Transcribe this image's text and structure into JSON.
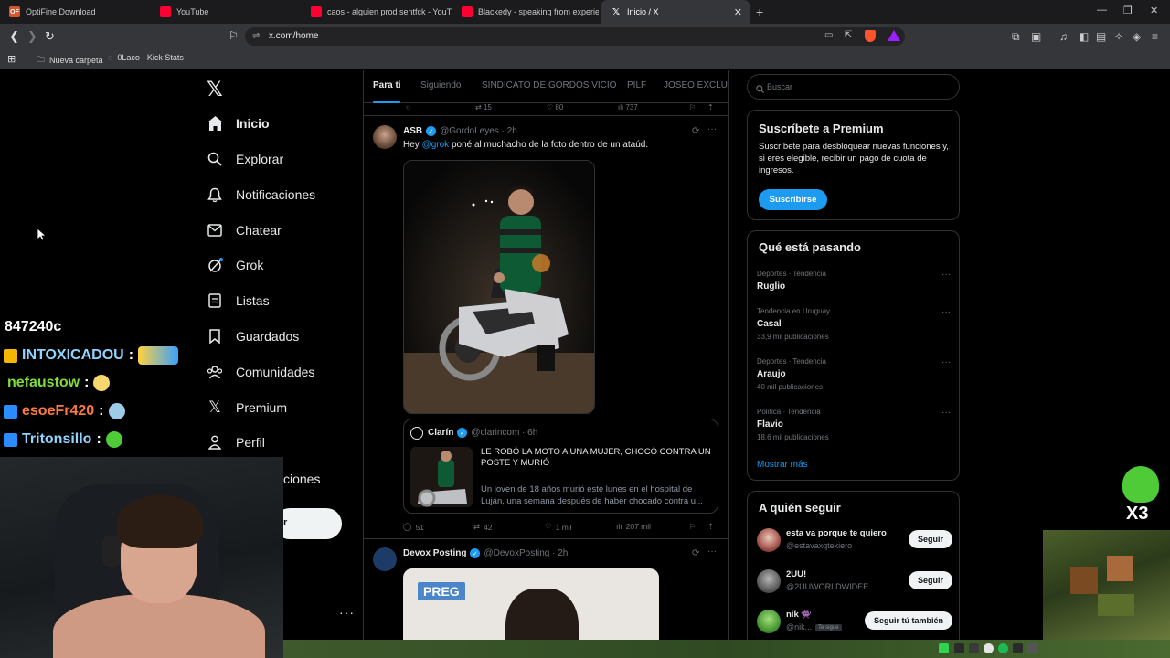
{
  "browser": {
    "tabs": [
      {
        "label": "OptiFine Download",
        "favicon": "OF"
      },
      {
        "label": "YouTube"
      },
      {
        "label": "caos - alguien prod sentfck - YouTub"
      },
      {
        "label": "Blackedy - speaking from experience"
      },
      {
        "label": "Inicio / X"
      }
    ],
    "url": "x.com/home",
    "bookmarks": [
      "Nueva carpeta",
      "0Laco - Kick Stats"
    ]
  },
  "sidebar": {
    "items": [
      {
        "label": "Inicio",
        "icon": "home-icon"
      },
      {
        "label": "Explorar",
        "icon": "search-icon"
      },
      {
        "label": "Notificaciones",
        "icon": "bell-icon"
      },
      {
        "label": "Chatear",
        "icon": "mail-icon"
      },
      {
        "label": "Grok",
        "icon": "grok-icon"
      },
      {
        "label": "Listas",
        "icon": "list-icon"
      },
      {
        "label": "Guardados",
        "icon": "bookmark-icon"
      },
      {
        "label": "Comunidades",
        "icon": "people-icon"
      },
      {
        "label": "Premium",
        "icon": "x-icon"
      },
      {
        "label": "Perfil",
        "icon": "person-icon"
      },
      {
        "label": "ciones"
      },
      {
        "label": "r"
      }
    ]
  },
  "timeline": {
    "tabs": [
      "Para ti",
      "Siguiendo",
      "SINDICATO DE GORDOS VICIO",
      "PILF",
      "JOSEO EXCLUSI"
    ],
    "prev_counts": {
      "retweets": "15",
      "likes": "80",
      "views": "737"
    },
    "tweet1": {
      "name": "ASB",
      "handle": "@GordoLeyes · 2h",
      "text_pre": "Hey ",
      "mention": "@grok",
      "text_post": " poné al muchacho de la foto dentro de un ataúd.",
      "quote": {
        "name": "Clarín",
        "handle": "@clarincom · 6h",
        "title": "LE ROBÓ LA MOTO A UNA MUJER, CHOCÓ CONTRA UN POSTE Y MURIÓ",
        "body": "Un joven de 18 años murió este lunes en el hospital de Luján, una semana después de haber chocado contra u..."
      },
      "replies": "51",
      "retweets": "42",
      "likes": "1 mil",
      "views": "207 mil"
    },
    "tweet2": {
      "name": "Devox Posting",
      "handle": "@DevoxPosting · 2h",
      "badge": "PREG"
    }
  },
  "right": {
    "search_placeholder": "Buscar",
    "premium": {
      "title": "Suscríbete a Premium",
      "text": "Suscríbete para desbloquear nuevas funciones y, si eres elegible, recibir un pago de cuota de ingresos.",
      "button": "Suscribirse"
    },
    "trends": {
      "title": "Qué está pasando",
      "items": [
        {
          "context": "Deportes · Tendencia",
          "name": "Ruglio",
          "count": ""
        },
        {
          "context": "Tendencia en Uruguay",
          "name": "Casal",
          "count": "33,9 mil publicaciones"
        },
        {
          "context": "Deportes · Tendencia",
          "name": "Araujo",
          "count": "40 mil publicaciones"
        },
        {
          "context": "Política · Tendencia",
          "name": "Flavio",
          "count": "18,6 mil publicaciones"
        }
      ],
      "more": "Mostrar más"
    },
    "follow": {
      "title": "A quién seguir",
      "items": [
        {
          "name": "esta va porque te quiero",
          "handle": "@estavaxqtekiero",
          "button": "Seguir"
        },
        {
          "name": "2UU!",
          "handle": "@2UUWORLDWIDEE",
          "button": "Seguir"
        },
        {
          "name": "nik 👾",
          "handle": "@nik...",
          "badge": "Te sigue",
          "button": "Seguir tú también"
        }
      ]
    }
  },
  "overlay": {
    "counter": "847240c",
    "chat": [
      {
        "user": "INTOXICADOU",
        "color": "#8fd4ff",
        "badge_color": "#f2b705"
      },
      {
        "user": "nefaustow",
        "color": "#7ddc3a",
        "badge_color": ""
      },
      {
        "user": "esoeFr420",
        "color": "#ff7a3c",
        "badge_color": "#2a8cff"
      },
      {
        "user": "Tritonsillo",
        "color": "#8fd4ff",
        "badge_color": "#2a8cff"
      }
    ],
    "frog_label": "X3"
  }
}
